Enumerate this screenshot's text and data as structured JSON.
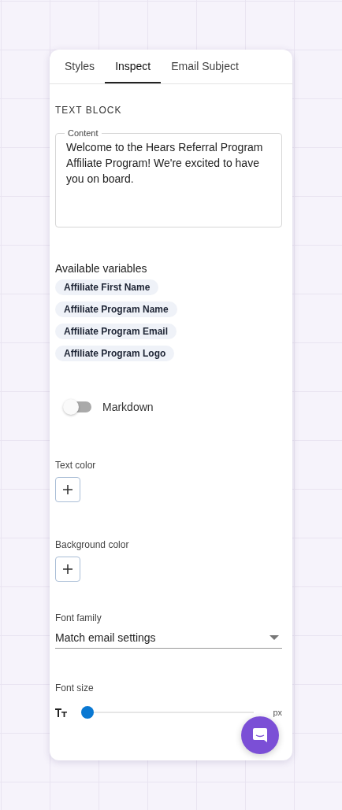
{
  "tabs": [
    {
      "label": "Styles",
      "selected": false
    },
    {
      "label": "Inspect",
      "selected": true
    },
    {
      "label": "Email Subject",
      "selected": false
    }
  ],
  "section_title": "TEXT BLOCK",
  "content_field": {
    "label": "Content",
    "value": "Welcome to the Hears Referral Program Affiliate Program! We're excited to have you on board."
  },
  "variables": {
    "title": "Available variables",
    "items": [
      "Affiliate First Name",
      "Affiliate Program Name",
      "Affiliate Program Email",
      "Affiliate Program Logo"
    ]
  },
  "markdown": {
    "label": "Markdown",
    "on": false
  },
  "text_color": {
    "label": "Text color"
  },
  "background_color": {
    "label": "Background color"
  },
  "font_family": {
    "label": "Font family",
    "value": "Match email settings"
  },
  "font_size": {
    "label": "Font size",
    "level": 0,
    "unit": "px"
  }
}
